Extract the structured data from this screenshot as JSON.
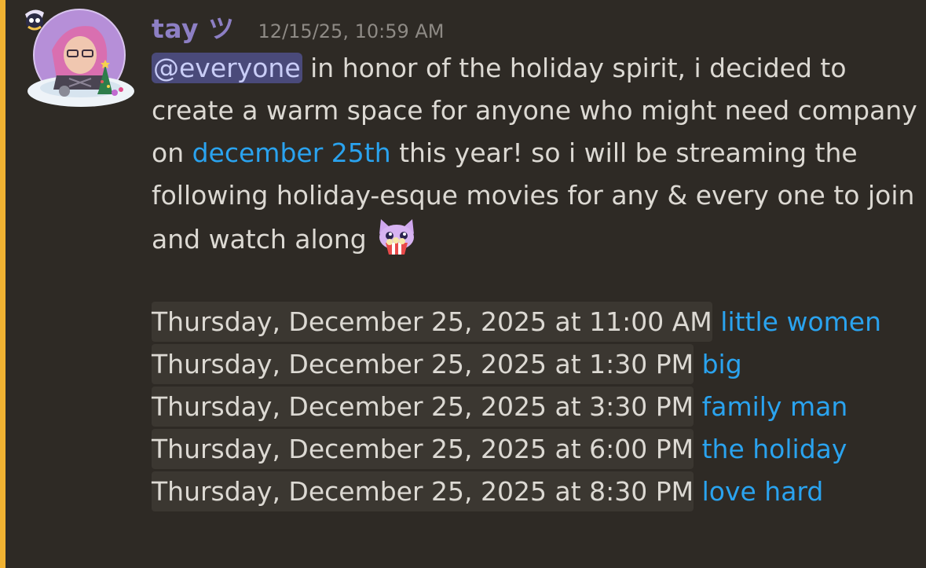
{
  "message": {
    "author": "tay ツ",
    "timestamp": "12/15/25, 10:59 AM",
    "mention": "@everyone",
    "text_1": " in honor of the holiday spirit, i decided to create a warm space for anyone who might need company on ",
    "date_link": "december 25th",
    "text_2": " this year! so i will be streaming the following holiday-esque movies for any & every one to join and watch along ",
    "schedule": [
      {
        "time": "Thursday, December 25, 2025 at 11:00 AM",
        "title": "little women"
      },
      {
        "time": "Thursday, December 25, 2025 at 1:30 PM",
        "title": "big"
      },
      {
        "time": "Thursday, December 25, 2025 at 3:30 PM",
        "title": "family man"
      },
      {
        "time": "Thursday, December 25, 2025 at 6:00 PM",
        "title": "the holiday"
      },
      {
        "time": "Thursday, December 25, 2025 at 8:30 PM",
        "title": "love hard"
      }
    ]
  },
  "icons": {
    "avatar": "avatar",
    "emoji": "cat-popcorn-emoji"
  },
  "colors": {
    "background": "#2e2a25",
    "mention_bar": "#f0b232",
    "username": "#8d7fc4",
    "link": "#2aa3ef",
    "mention_bg": "#4a4a7a",
    "timestamp_pill": "#3b3731"
  }
}
